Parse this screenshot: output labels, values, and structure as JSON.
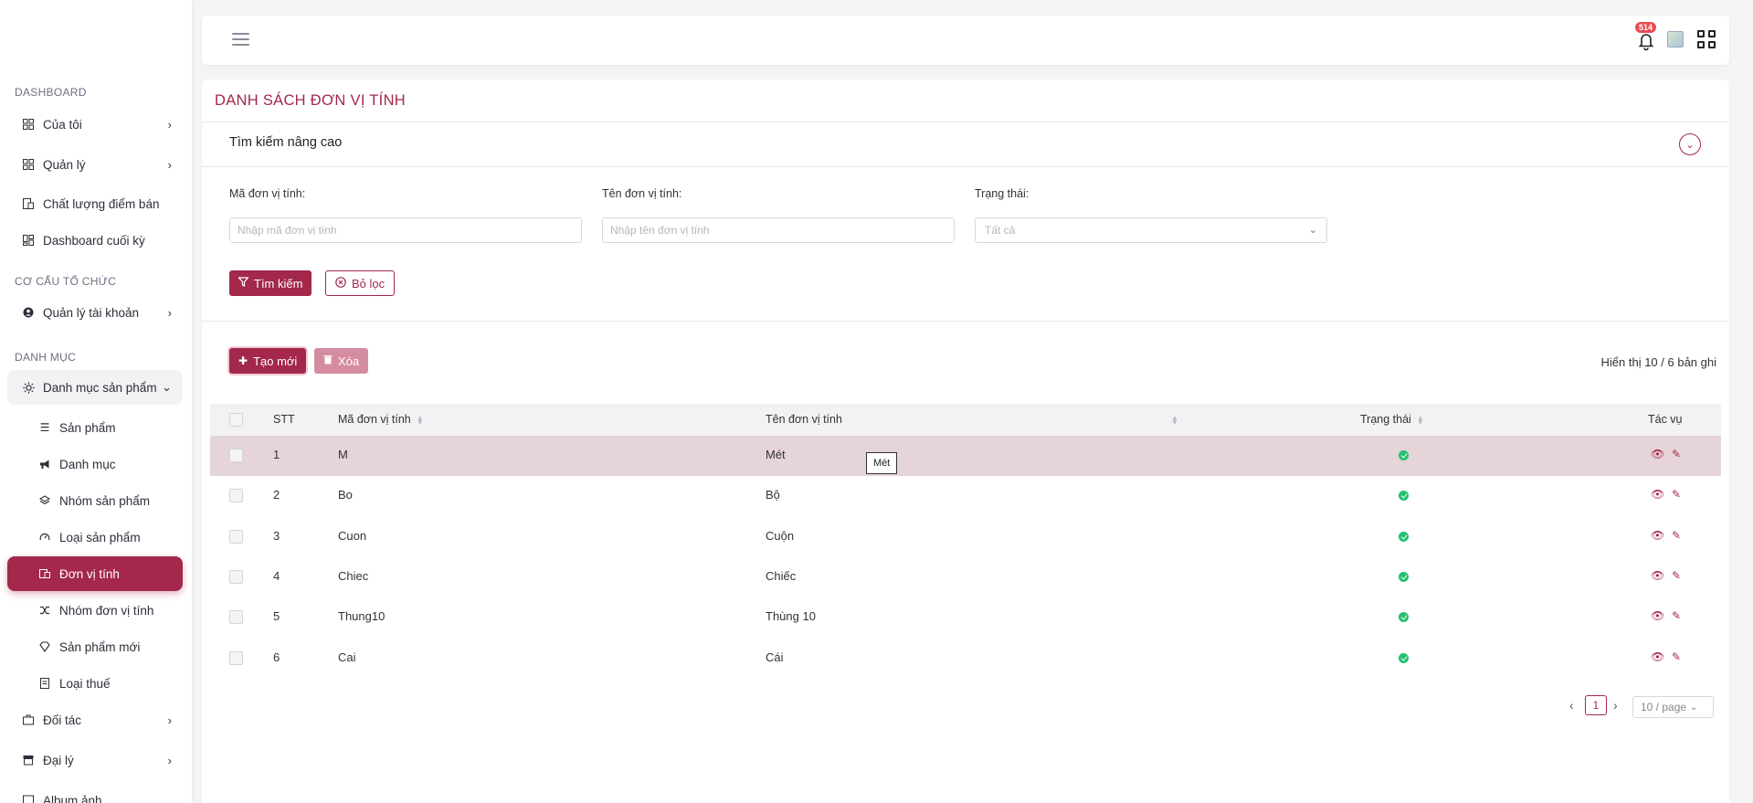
{
  "sidebar": {
    "groups": [
      {
        "title": "DASHBOARD"
      },
      {
        "title": "CƠ CẤU TỔ CHỨC"
      },
      {
        "title": "DANH MỤC"
      }
    ],
    "items": [
      {
        "label": "Của tôi"
      },
      {
        "label": "Quản lý"
      },
      {
        "label": "Chất lượng điểm bán"
      },
      {
        "label": "Dashboard cuối kỳ"
      },
      {
        "label": "Quản lý tài khoản"
      },
      {
        "label": "Danh mục sản phẩm"
      },
      {
        "label": "Đối tác"
      },
      {
        "label": "Đại lý"
      },
      {
        "label": "Album ảnh"
      }
    ],
    "subitems": [
      {
        "label": "Sản phẩm"
      },
      {
        "label": "Danh mục"
      },
      {
        "label": "Nhóm sản phẩm"
      },
      {
        "label": "Loại sản phẩm"
      },
      {
        "label": "Đơn vị tính"
      },
      {
        "label": "Nhóm đơn vị tính"
      },
      {
        "label": "Sản phẩm mới"
      },
      {
        "label": "Loại thuế"
      }
    ]
  },
  "header": {
    "notification_count": "514"
  },
  "page": {
    "title": "DANH SÁCH ĐƠN VỊ TÍNH",
    "advanced_search": "Tìm kiếm nâng cao",
    "filters": {
      "code_label": "Mã đơn vị tính:",
      "code_placeholder": "Nhập mã đơn vị tính",
      "name_label": "Tên đơn vị tính:",
      "name_placeholder": "Nhập tên đơn vị tính",
      "status_label": "Trạng thái:",
      "status_value": "Tất cả"
    },
    "search_button": "Tìm kiếm",
    "clear_button": "Bỏ lọc",
    "create_button": "Tạo mới",
    "delete_button": "Xóa",
    "records_info": "Hiển thị 10 / 6 bản ghi"
  },
  "table": {
    "headers": [
      "STT",
      "Mã đơn vị tính",
      "Tên đơn vị tính",
      "Trạng thái",
      "Tác vụ"
    ],
    "rows": [
      {
        "stt": "1",
        "code": "M",
        "name": "Mét"
      },
      {
        "stt": "2",
        "code": "Bo",
        "name": "Bộ"
      },
      {
        "stt": "3",
        "code": "Cuon",
        "name": "Cuộn"
      },
      {
        "stt": "4",
        "code": "Chiec",
        "name": "Chiếc"
      },
      {
        "stt": "5",
        "code": "Thung10",
        "name": "Thùng 10"
      },
      {
        "stt": "6",
        "code": "Cai",
        "name": "Cái"
      }
    ],
    "tooltip": "Mét"
  },
  "pagination": {
    "current": "1",
    "page_size": "10 / page"
  },
  "colors": {
    "accent": "#a3284b",
    "status_active": "#24c16e"
  }
}
